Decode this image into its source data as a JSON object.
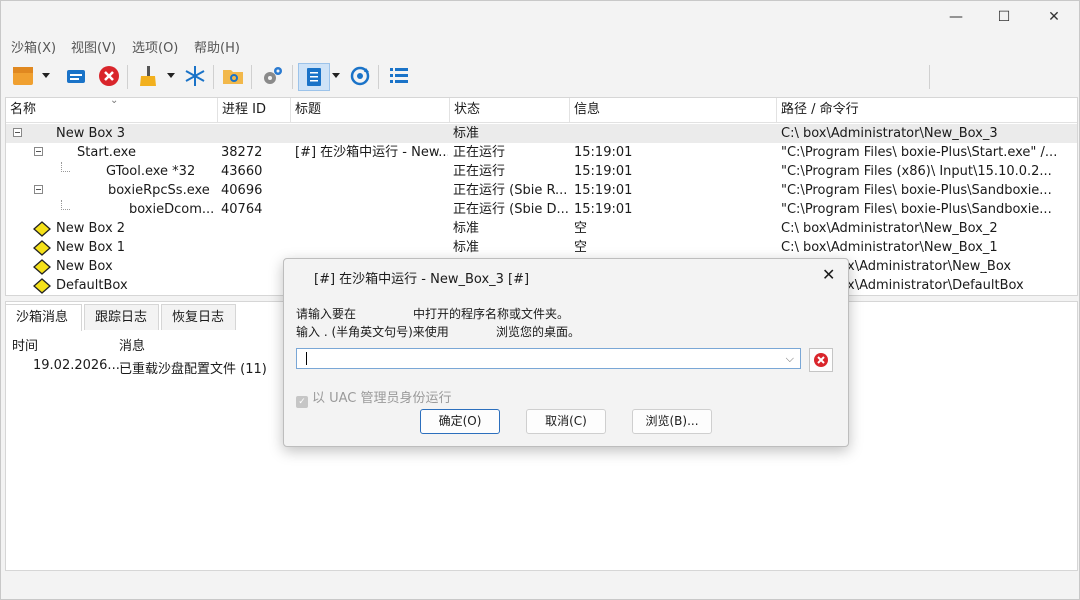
{
  "menu": [
    "沙箱(X)",
    "视图(V)",
    "选项(O)",
    "帮助(H)"
  ],
  "window_controls": {
    "minimize": "—",
    "maximize": "☐",
    "close": "✕"
  },
  "columns": [
    "名称",
    "进程 ID",
    "标题",
    "状态",
    "信息",
    "路径 / 命令行"
  ],
  "rows": [
    {
      "name": "New Box 3",
      "pid": "",
      "title": "",
      "status": "标准",
      "info": "",
      "path": "C:\\       box\\Administrator\\New_Box_3"
    },
    {
      "name": "Start.exe",
      "pid": "38272",
      "title": "[#] 在沙箱中运行 - New...",
      "status": "正在运行",
      "info": "15:19:01",
      "path": "\"C:\\Program Files\\       boxie-Plus\\Start.exe\" /..."
    },
    {
      "name": "GTool.exe *32",
      "pid": "43660",
      "title": "",
      "status": "正在运行",
      "info": "15:19:01",
      "path": "\"C:\\Program Files (x86)\\       Input\\15.10.0.2..."
    },
    {
      "name": "boxieRpcSs.exe",
      "pid": "40696",
      "title": "",
      "status": "正在运行 (Sbie R...",
      "info": "15:19:01",
      "path": "\"C:\\Program Files\\       boxie-Plus\\Sandboxie..."
    },
    {
      "name": "boxieDcom...",
      "pid": "40764",
      "title": "",
      "status": "正在运行 (Sbie D...",
      "info": "15:19:01",
      "path": "\"C:\\Program Files\\       boxie-Plus\\Sandboxie..."
    },
    {
      "name": "New Box 2",
      "pid": "",
      "title": "",
      "status": "标准",
      "info": "空",
      "path": "C:\\       box\\Administrator\\New_Box_2"
    },
    {
      "name": "New Box 1",
      "pid": "",
      "title": "",
      "status": "标准",
      "info": "空",
      "path": "C:\\       box\\Administrator\\New_Box_1"
    },
    {
      "name": "New Box",
      "pid": "",
      "title": "",
      "status": "",
      "info": "",
      "path": "x\\Administrator\\New_Box"
    },
    {
      "name": "DefaultBox",
      "pid": "",
      "title": "",
      "status": "",
      "info": "",
      "path": "x\\Administrator\\DefaultBox"
    }
  ],
  "tabs": [
    "沙箱消息",
    "跟踪日志",
    "恢复日志"
  ],
  "log": {
    "headers": [
      "时间",
      "消息"
    ],
    "rows": [
      {
        "time": "19.02.2026...",
        "message": "已重载沙盘配置文件 (11)"
      }
    ]
  },
  "dialog": {
    "title": "[#] 在沙箱中运行 - New_Box_3 [#]",
    "line1a": "请输入要在",
    "line1b": "中打开的程序名称或文件夹。",
    "line2a": "输入 . (半角英文句号)来使用",
    "line2b": "浏览您的桌面。",
    "input_value": "",
    "uac_label": "以 UAC 管理员身份运行",
    "ok": "确定(O)",
    "cancel": "取消(C)",
    "browse": "浏览(B)..."
  },
  "colors": {
    "accent": "#2c6fbd",
    "error_red": "#d9252b",
    "sandbox_yellow": "#f5e11a",
    "toolbar_blue": "#1a73c8"
  }
}
